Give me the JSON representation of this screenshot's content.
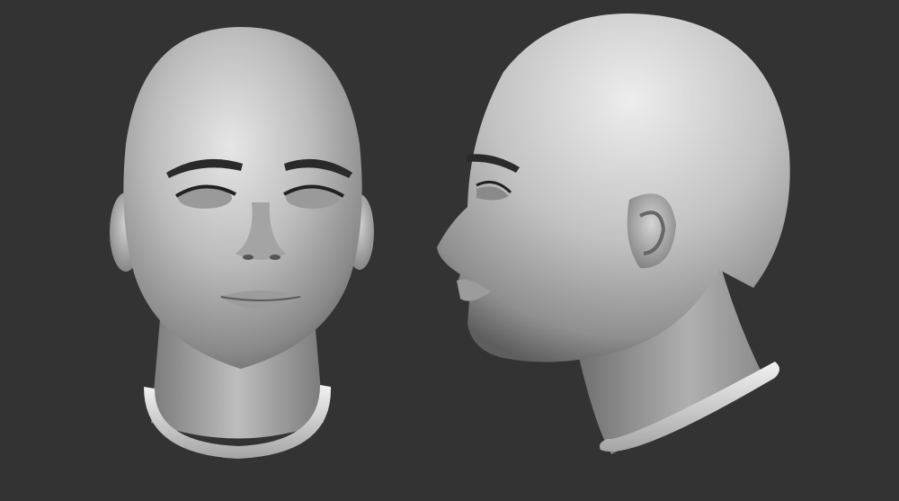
{
  "scene": {
    "background_color": "#333333",
    "material_color": "#bdbdbd",
    "shadow_color": "#4a4a4a",
    "highlight_color": "#efefef",
    "views": [
      {
        "name": "front-view",
        "subject": "bald-head-bust"
      },
      {
        "name": "profile-view",
        "subject": "bald-head-bust"
      }
    ]
  }
}
